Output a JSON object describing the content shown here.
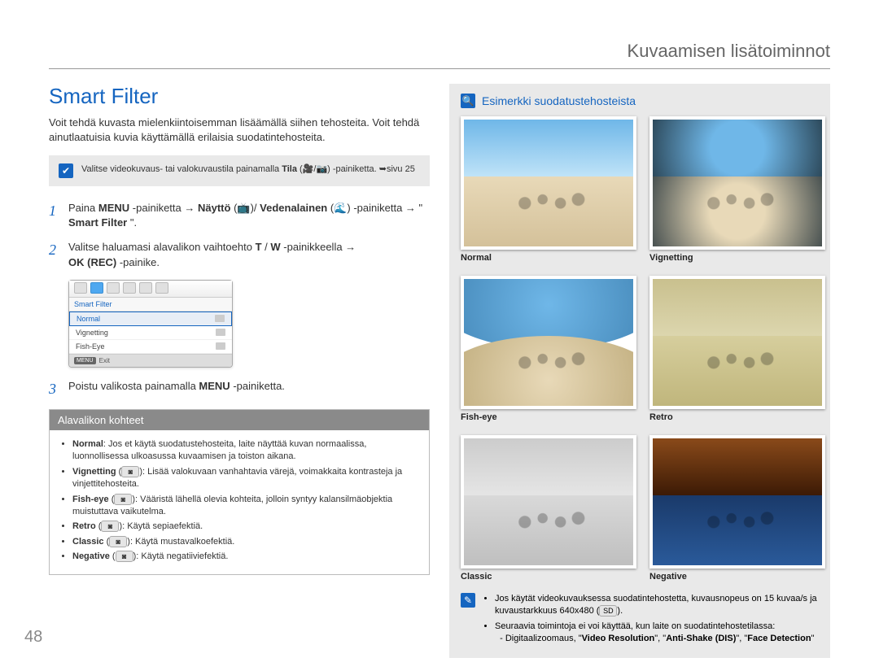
{
  "header": {
    "title": "Kuvaamisen lisätoiminnot"
  },
  "section": {
    "title": "Smart Filter",
    "intro": "Voit tehdä kuvasta mielenkiintoisemman lisäämällä siihen tehosteita. Voit tehdä ainutlaatuisia kuvia käyttämällä erilaisia suodatintehosteita."
  },
  "note": {
    "line1": "Valitse videokuvaus- tai valokuvaustila painamalla ",
    "keyword": "Tila",
    "icons_desc": "(video/valokuva)",
    "line2": "-painiketta. ➥sivu 25"
  },
  "steps": [
    {
      "num": "1",
      "prefix": "Paina ",
      "b1": "MENU",
      "mid1": "-painiketta → ",
      "b2": "Näyttö",
      "mid2": " (📺)/",
      "b3": "Vedenalainen",
      "mid3": " (🌊) -painiketta → \"",
      "b4": "Smart Filter",
      "suffix": "\"."
    },
    {
      "num": "2",
      "text1": "Valitse haluamasi alavalikon vaihtoehto ",
      "b1": "T",
      "sep": " / ",
      "b2": "W",
      "text2": "-painikkeella → ",
      "b3": "OK (REC)",
      "text3": "-painike."
    },
    {
      "num": "3",
      "text1": "Poistu valikosta painamalla ",
      "b1": "MENU",
      "text2": "-painiketta."
    }
  ],
  "menu_screenshot": {
    "title": "Smart Filter",
    "rows": [
      "Normal",
      "Vignetting",
      "Fish-Eye"
    ],
    "exit": "Exit",
    "menu_btn": "MENU"
  },
  "submenu": {
    "header": "Alavalikon kohteet",
    "items": [
      {
        "b": "Normal",
        "text": ": Jos et käytä suodatustehosteita, laite näyttää kuvan normaalissa, luonnollisessa ulkoasussa kuvaamisen ja toiston aikana."
      },
      {
        "b": "Vignetting",
        "badge": "◙",
        "text": ": Lisää valokuvaan vanhahtavia värejä, voimakkaita kontrasteja ja vinjettitehosteita."
      },
      {
        "b": "Fish-eye",
        "badge": "◙",
        "text": ": Vääristä lähellä olevia kohteita, jolloin syntyy kalansilmäobjektia muistuttava vaikutelma."
      },
      {
        "b": "Retro",
        "badge": "◙",
        "text": ": Käytä sepiaefektiä."
      },
      {
        "b": "Classic",
        "badge": "◙",
        "text": ": Käytä mustavalkoefektiä."
      },
      {
        "b": "Negative",
        "badge": "◙",
        "text": ": Käytä negatiiviefektiä."
      }
    ]
  },
  "right": {
    "title": "Esimerkki suodatustehosteista",
    "thumbs": [
      {
        "label": "Normal",
        "cls": "th-normal"
      },
      {
        "label": "Vignetting",
        "cls": "th-vign"
      },
      {
        "label": "Fish-eye",
        "cls": "th-fish"
      },
      {
        "label": "Retro",
        "cls": "th-retro"
      },
      {
        "label": "Classic",
        "cls": "th-classic"
      },
      {
        "label": "Negative",
        "cls": "th-negative"
      }
    ],
    "notes": [
      {
        "pre": "Jos käytät videokuvauksessa suodatintehostetta, kuvausnopeus on 15 kuvaa/s ja kuvaustarkkuus 640x480 (",
        "badge": "SD",
        "post": ")."
      },
      {
        "pre": "Seuraavia toimintoja ei voi käyttää, kun laite on suodatintehostetilassa:",
        "sub": "- Digitaalizoomaus, \"Video Resolution\", \"Anti-Shake (DIS)\", \"Face Detection\""
      }
    ]
  },
  "page_number": "48"
}
